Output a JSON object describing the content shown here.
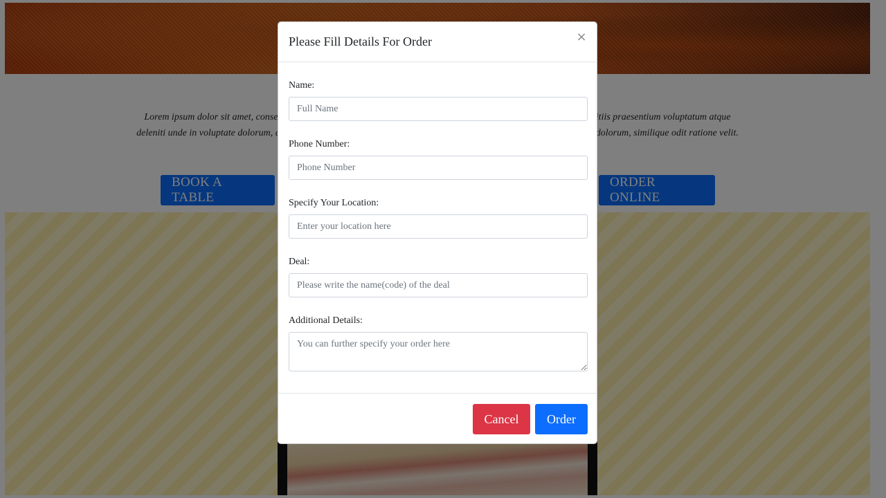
{
  "background_page": {
    "intro_line1": "Lorem ipsum dolor sit amet, consectetur adipisicing elit. Voluptatum at accusantium, dignissimos ducimus qui blanditiis praesentium voluptatum atque",
    "intro_line2": "deleniti unde in voluptate dolorum, cupiditate quos laudantium? Repellat excepturi vitae praesentium magnam, porro dolorum, similique odit ratione velit.",
    "book_button_label": "BOOK A TABLE",
    "order_online_button_label": "ORDER ONLINE"
  },
  "modal": {
    "title": "Please Fill Details For Order",
    "close_symbol": "×",
    "fields": {
      "name": {
        "label": "Name:",
        "placeholder": "Full Name",
        "value": ""
      },
      "phone": {
        "label": "Phone Number:",
        "placeholder": "Phone Number",
        "value": ""
      },
      "location": {
        "label": "Specify Your Location:",
        "placeholder": "Enter your location here",
        "value": ""
      },
      "deal": {
        "label": "Deal:",
        "placeholder": "Please write the name(code) of the deal",
        "value": ""
      },
      "details": {
        "label": "Additional Details:",
        "placeholder": "You can further specify your order here",
        "value": ""
      }
    },
    "cancel_label": "Cancel",
    "order_label": "Order"
  },
  "colors": {
    "primary": "#0d6efd",
    "danger": "#dc3545",
    "backdrop": "rgba(0,0,0,0.5)"
  }
}
